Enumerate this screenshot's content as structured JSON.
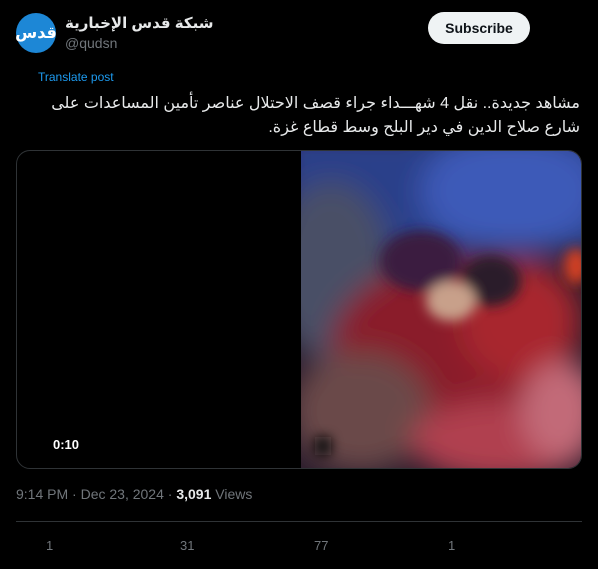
{
  "author": {
    "avatar_text": "قدس",
    "name": "شبكة قدس الإخبارية",
    "handle": "@qudsn"
  },
  "header": {
    "subscribe_label": "Subscribe"
  },
  "post": {
    "translate_label": "Translate post",
    "text": "مشاهد جديدة.. نقل 4 شهـــداء جراء قصف الاحتلال عناصر تأمين المساعدات على شارع صلاح الدين في دير البلح وسط قطاع غزة.",
    "video_duration": "0:10"
  },
  "meta": {
    "time": "9:14 PM",
    "separator": "·",
    "date": "Dec 23, 2024",
    "views_count": "3,091",
    "views_label": "Views"
  },
  "actions": {
    "replies": "1",
    "reposts": "31",
    "likes": "77",
    "bookmarks": "1"
  },
  "colors": {
    "background": "#000000",
    "accent": "#1d9bf0",
    "muted": "#71767b",
    "avatar": "#1d87d6"
  }
}
